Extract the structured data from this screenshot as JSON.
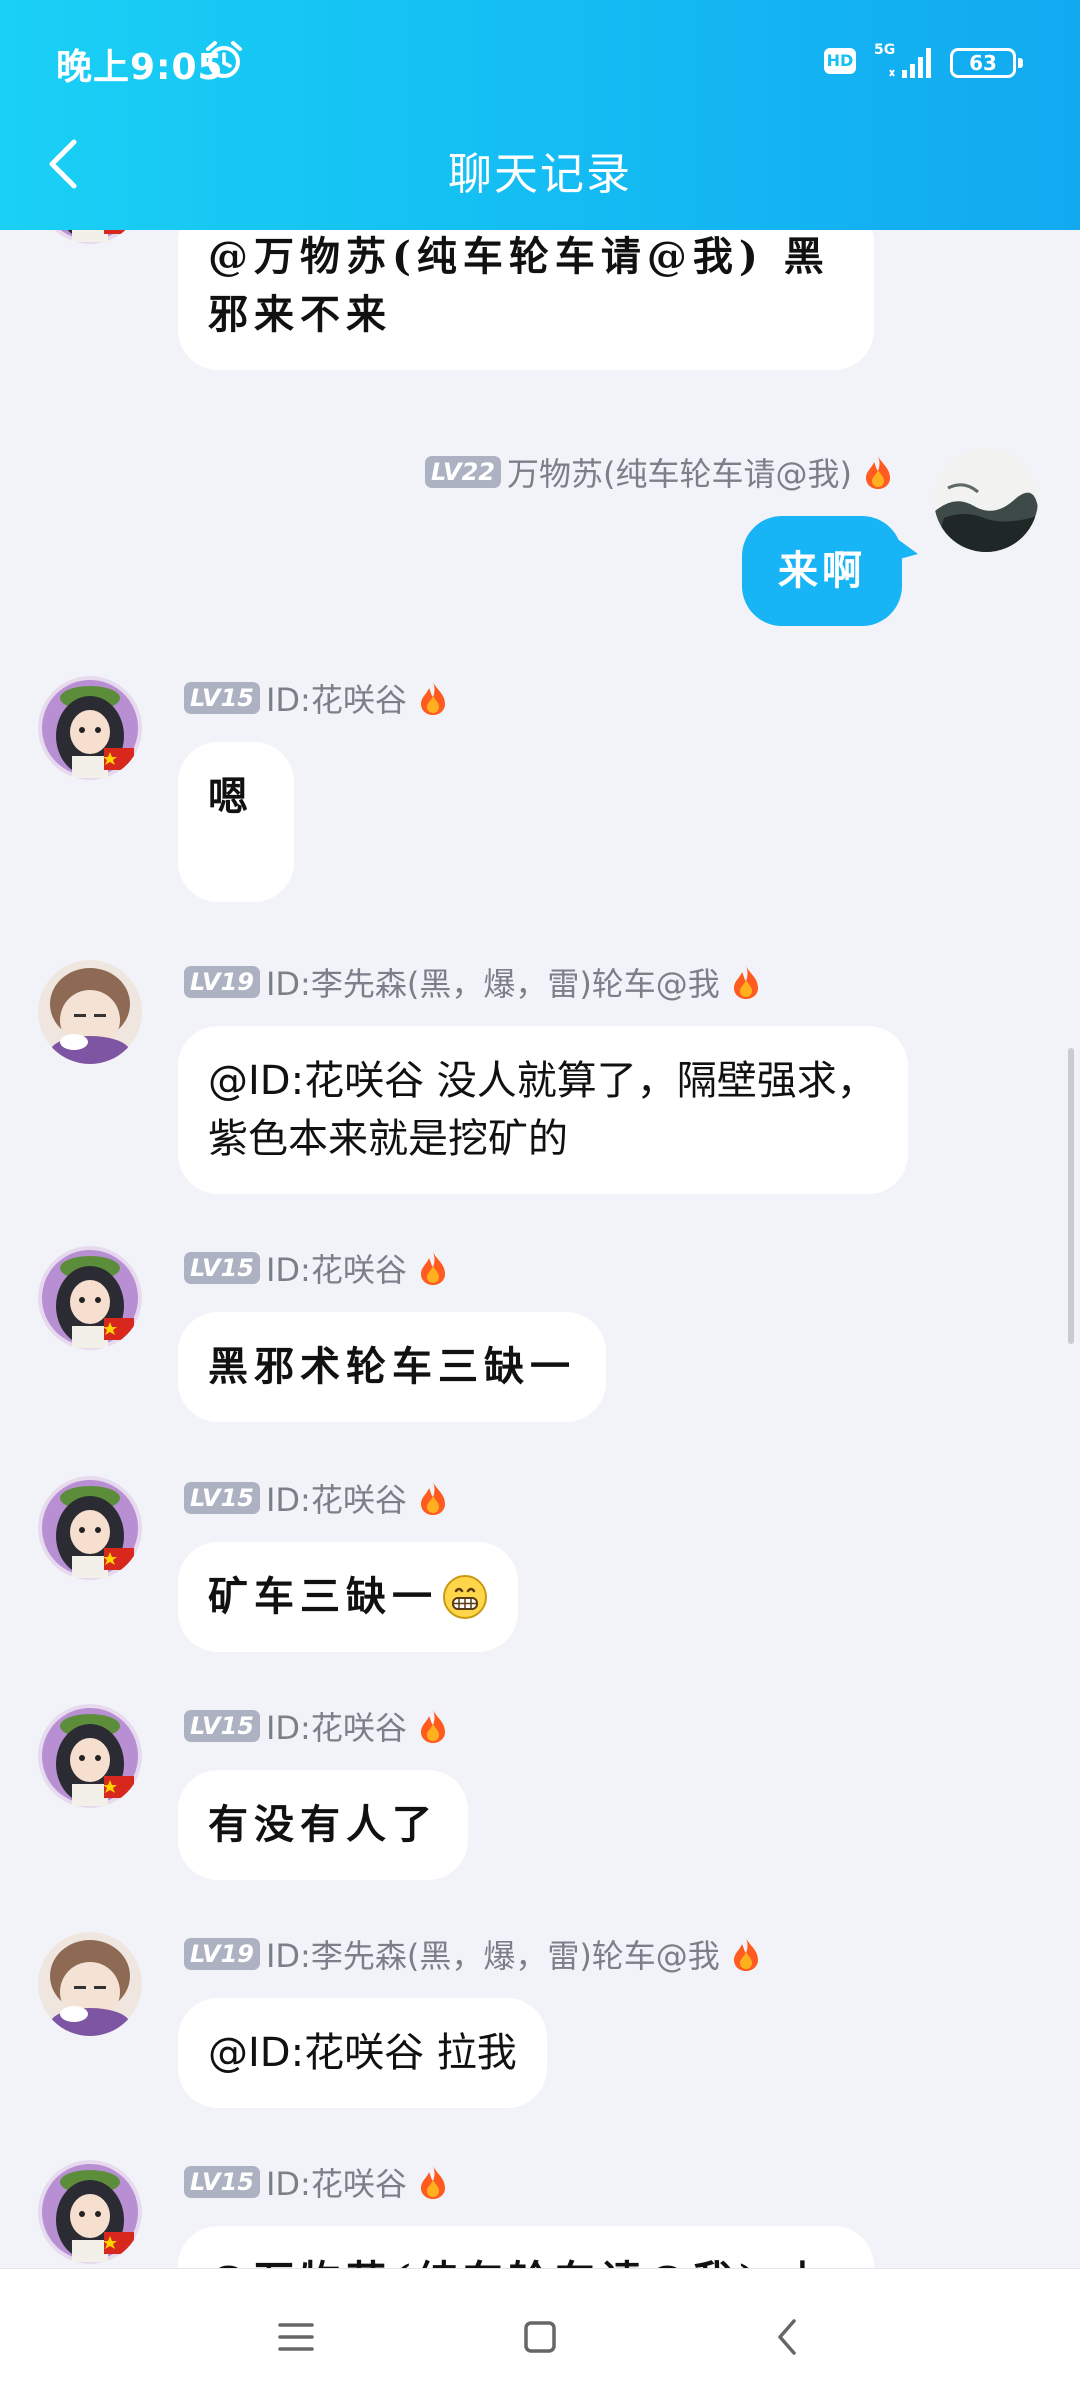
{
  "status_bar": {
    "time": "晚上9:05",
    "hd_label": "HD",
    "network_label": "5G",
    "battery_level": "63",
    "icons": [
      "alarm-icon",
      "signal-icon",
      "battery-icon"
    ]
  },
  "header": {
    "title": "聊天记录",
    "back_icon": "chevron-left-icon"
  },
  "colors": {
    "header_gradient_start": "#1ad0f5",
    "header_gradient_end": "#12a9f0",
    "my_bubble": "#17b4f6",
    "background": "#f2f3f8",
    "level_badge": "#adb2c3"
  },
  "messages": [
    {
      "side": "left",
      "level": "",
      "nickname": "",
      "text": "@万物苏(纯车轮车请@我) 黑邪来不来",
      "avatar": "anime-girl-leaf-avatar"
    },
    {
      "side": "right",
      "level": "LV22",
      "nickname": "万物苏(纯车轮车请@我)",
      "text": "来啊",
      "avatar": "ink-landscape-avatar"
    },
    {
      "side": "left",
      "level": "LV15",
      "nickname": "ID:花咲谷",
      "text": "嗯",
      "avatar": "anime-girl-leaf-avatar"
    },
    {
      "side": "left",
      "level": "LV19",
      "nickname": "ID:李先森(黑，爆，雷)轮车@我",
      "text": "@ID:花咲谷 没人就算了，隔壁强求，紫色本来就是挖矿的",
      "avatar": "anime-boy-avatar"
    },
    {
      "side": "left",
      "level": "LV15",
      "nickname": "ID:花咲谷",
      "text": "黑邪术轮车三缺一",
      "avatar": "anime-girl-leaf-avatar"
    },
    {
      "side": "left",
      "level": "LV15",
      "nickname": "ID:花咲谷",
      "text": "矿车三缺一",
      "emoji": "grinning-face-emoji",
      "avatar": "anime-girl-leaf-avatar"
    },
    {
      "side": "left",
      "level": "LV15",
      "nickname": "ID:花咲谷",
      "text": "有没有人了",
      "avatar": "anime-girl-leaf-avatar"
    },
    {
      "side": "left",
      "level": "LV19",
      "nickname": "ID:李先森(黑，爆，雷)轮车@我",
      "text": "@ID:花咲谷 拉我",
      "avatar": "anime-boy-avatar"
    },
    {
      "side": "left",
      "level": "LV15",
      "nickname": "ID:花咲谷",
      "text": "@万物苏(纯车轮车请@我) 上线",
      "avatar": "anime-girl-leaf-avatar"
    }
  ],
  "navbar": {
    "icons": [
      "menu-icon",
      "home-square-icon",
      "back-triangle-icon"
    ]
  }
}
